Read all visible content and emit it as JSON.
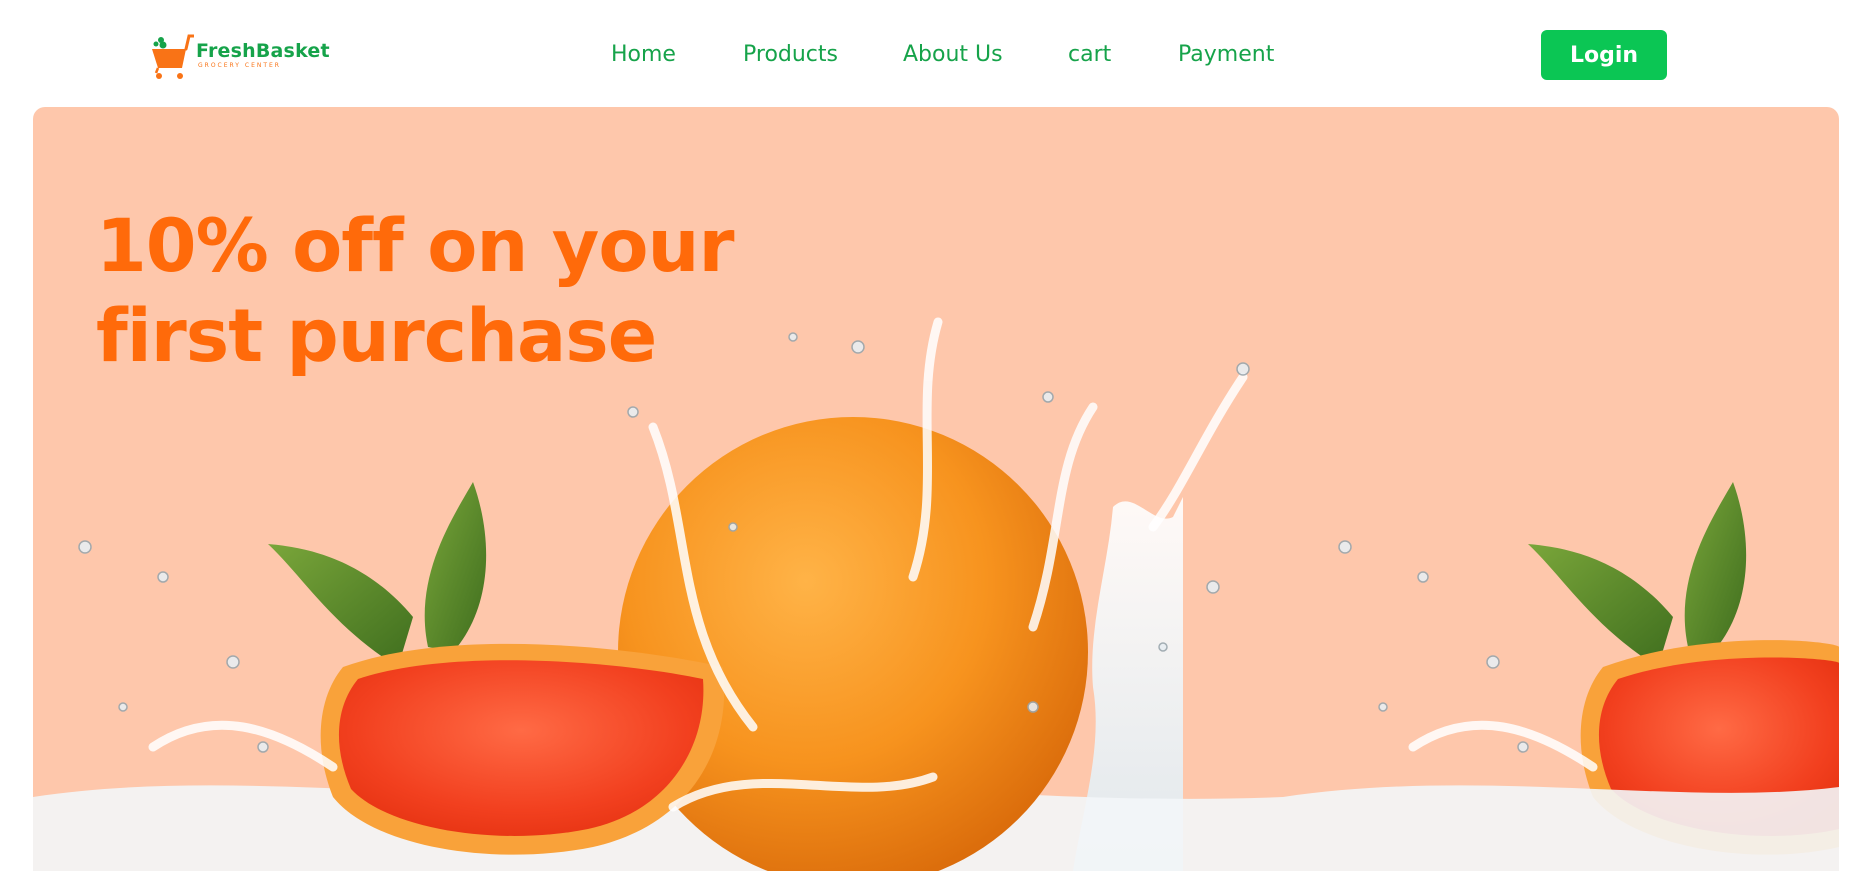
{
  "brand": {
    "name": "FreshBasket",
    "tagline": "GROCERY CENTER",
    "logo_icon": "shopping-cart-icon"
  },
  "nav": {
    "items": [
      {
        "label": "Home"
      },
      {
        "label": "Products"
      },
      {
        "label": "About Us"
      },
      {
        "label": "cart"
      },
      {
        "label": "Payment"
      }
    ]
  },
  "header": {
    "login_label": "Login"
  },
  "hero": {
    "heading_line1": "10% off on your",
    "heading_line2": "first purchase",
    "image": "grapefruit-water-splash-image"
  },
  "colors": {
    "brand_green": "#16a34a",
    "login_button": "#0bc654",
    "hero_background": "#fec7ab",
    "hero_heading": "#ff6a0a"
  }
}
